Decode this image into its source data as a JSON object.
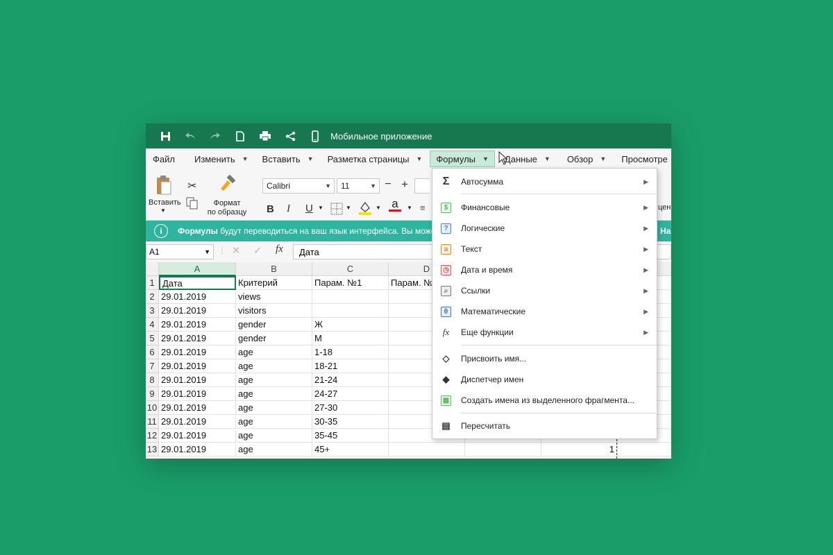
{
  "titlebar": {
    "title": "Мобильное приложение",
    "icons": [
      "save-icon",
      "undo-icon",
      "redo-icon",
      "new-document-icon",
      "print-icon",
      "share-icon",
      "mobile-phone-icon"
    ]
  },
  "menubar": {
    "items": [
      {
        "label": "Файл",
        "has_caret": false
      },
      {
        "label": "Изменить",
        "has_caret": true
      },
      {
        "label": "Вставить",
        "has_caret": true
      },
      {
        "label": "Разметка страницы",
        "has_caret": true
      },
      {
        "label": "Формулы",
        "has_caret": true,
        "active": true
      },
      {
        "label": "Данные",
        "has_caret": true
      },
      {
        "label": "Обзор",
        "has_caret": true
      },
      {
        "label": "Просмотре",
        "has_caret": false
      }
    ]
  },
  "ribbon": {
    "paste_label": "Вставить",
    "format_painter_label_1": "Формат",
    "format_painter_label_2": "по образцу",
    "font_name": "Calibri",
    "font_size": "11",
    "bold": "B",
    "italic": "I",
    "underline": "U",
    "font_color_glyph": "a",
    "clipped_right": "цен",
    "fill_color": "#f2e600",
    "font_color": "#d01818"
  },
  "notification": {
    "icon": "info-icon",
    "bold": "Формулы",
    "text": " будут переводиться на ваш язык интерфейса. Вы може",
    "right": "Нас"
  },
  "formula_bar": {
    "cell_ref": "A1",
    "fx": "fx",
    "value": "Дата"
  },
  "grid": {
    "columns": [
      "A",
      "B",
      "C",
      "D"
    ],
    "rows": [
      {
        "n": "1",
        "a": "Дата",
        "b": "Критерий",
        "c": "Парам. №1",
        "d": "Парам. №"
      },
      {
        "n": "2",
        "a": "29.01.2019",
        "b": "views",
        "c": "",
        "d": ""
      },
      {
        "n": "3",
        "a": "29.01.2019",
        "b": "visitors",
        "c": "",
        "d": ""
      },
      {
        "n": "4",
        "a": "29.01.2019",
        "b": "gender",
        "c": "Ж",
        "d": ""
      },
      {
        "n": "5",
        "a": "29.01.2019",
        "b": "gender",
        "c": "М",
        "d": ""
      },
      {
        "n": "6",
        "a": "29.01.2019",
        "b": "age",
        "c": "1-18",
        "d": ""
      },
      {
        "n": "7",
        "a": "29.01.2019",
        "b": "age",
        "c": "18-21",
        "d": ""
      },
      {
        "n": "8",
        "a": "29.01.2019",
        "b": "age",
        "c": "21-24",
        "d": ""
      },
      {
        "n": "9",
        "a": "29.01.2019",
        "b": "age",
        "c": "24-27",
        "d": ""
      },
      {
        "n": "10",
        "a": "29.01.2019",
        "b": "age",
        "c": "27-30",
        "d": ""
      },
      {
        "n": "11",
        "a": "29.01.2019",
        "b": "age",
        "c": "30-35",
        "d": ""
      },
      {
        "n": "12",
        "a": "29.01.2019",
        "b": "age",
        "c": "35-45",
        "d": ""
      },
      {
        "n": "13",
        "a": "29.01.2019",
        "b": "age",
        "c": "45+",
        "d": ""
      }
    ],
    "row13_e": "1"
  },
  "dropdown": {
    "items": [
      {
        "label": "Автосумма",
        "icon": "sigma-icon",
        "glyph": "Σ",
        "submenu": true
      },
      {
        "label": "Финансовые",
        "icon": "dollar-icon",
        "glyph": "$",
        "submenu": true,
        "color": "#5cb85c"
      },
      {
        "label": "Логические",
        "icon": "question-icon",
        "glyph": "?",
        "submenu": true,
        "color": "#4a7fd4"
      },
      {
        "label": "Текст",
        "icon": "text-a-icon",
        "glyph": "a",
        "submenu": true,
        "color": "#e08a1e"
      },
      {
        "label": "Дата и время",
        "icon": "clock-icon",
        "glyph": "◷",
        "submenu": true,
        "color": "#d9534f"
      },
      {
        "label": "Ссылки",
        "icon": "search-icon",
        "glyph": "⌕",
        "submenu": true,
        "color": "#777777"
      },
      {
        "label": "Математические",
        "icon": "theta-icon",
        "glyph": "θ",
        "submenu": true,
        "color": "#3a7ca5"
      },
      {
        "label": "Еще функции",
        "icon": "fx-icon",
        "glyph": "fx",
        "submenu": true
      },
      {
        "label": "Присвоить имя...",
        "icon": "tag-icon",
        "glyph": "◇",
        "submenu": false
      },
      {
        "label": "Диспетчер имен",
        "icon": "tags-icon",
        "glyph": "◆",
        "submenu": false
      },
      {
        "label": "Создать имена из выделенного фрагмента...",
        "icon": "table-names-icon",
        "glyph": "▦",
        "submenu": false,
        "color": "#5cb85c"
      },
      {
        "label": "Пересчитать",
        "icon": "calculator-icon",
        "glyph": "▤",
        "submenu": false
      }
    ]
  },
  "colors": {
    "background": "#1a9d68",
    "titlebar": "#17784f",
    "notification": "#2fb59f",
    "selection": "#17784f"
  }
}
